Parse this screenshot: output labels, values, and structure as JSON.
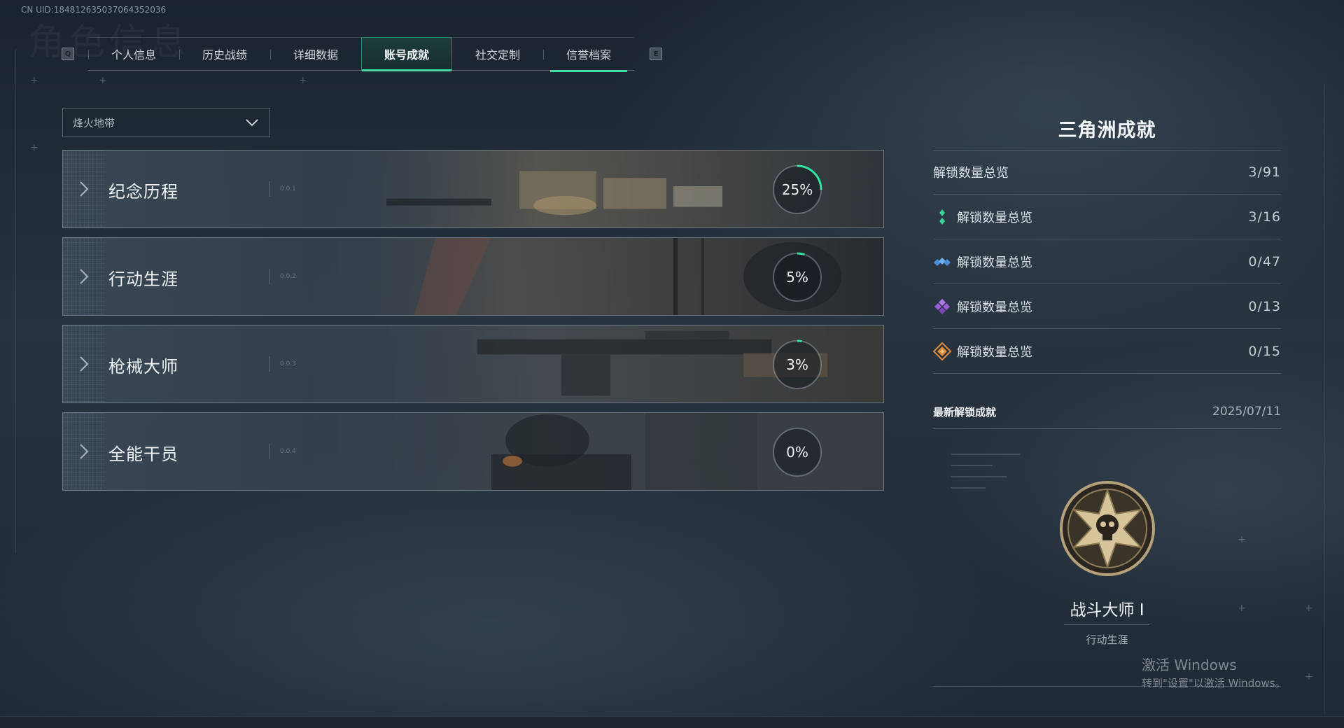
{
  "uid": "CN UID:18481263503706435203​6",
  "tabs": {
    "left_key": "Q",
    "right_key": "E",
    "items": [
      {
        "label": "个人信息"
      },
      {
        "label": "历史战绩"
      },
      {
        "label": "详细数据"
      },
      {
        "label": "账号成就",
        "active": true
      },
      {
        "label": "社交定制"
      },
      {
        "label": "信誉档案"
      }
    ]
  },
  "dropdown": {
    "value": "烽火地带"
  },
  "categories": [
    {
      "name": "纪念历程",
      "code": "0.0.1",
      "percent": 25
    },
    {
      "name": "行动生涯",
      "code": "0.0.2",
      "percent": 5
    },
    {
      "name": "枪械大师",
      "code": "0.0.3",
      "percent": 3
    },
    {
      "name": "全能干员",
      "code": "0.0.4",
      "percent": 0
    }
  ],
  "summary": {
    "title": "三角洲成就",
    "rows": [
      {
        "label": "解锁数量总览",
        "value": "3/91",
        "icon": "none"
      },
      {
        "label": "解锁数量总览",
        "value": "3/16",
        "icon": "green-tier-icon",
        "color": "#35d49a"
      },
      {
        "label": "解锁数量总览",
        "value": "0/47",
        "icon": "blue-tier-icon",
        "color": "#4a90d8"
      },
      {
        "label": "解锁数量总览",
        "value": "0/13",
        "icon": "purple-tier-icon",
        "color": "#9a5fd6"
      },
      {
        "label": "解锁数量总览",
        "value": "0/15",
        "icon": "gold-tier-icon",
        "color": "#e08a3c"
      }
    ]
  },
  "recent": {
    "heading": "最新解锁成就",
    "date": "2025/07/11",
    "achievement_name": "战斗大师 I",
    "achievement_category": "行动生涯",
    "badge_icon": "star-skull-badge-icon"
  },
  "watermark": {
    "line1": "激活 Windows",
    "line2": "转到\"设置\"以激活 Windows。"
  },
  "colors": {
    "accent": "#2ee6a0"
  }
}
